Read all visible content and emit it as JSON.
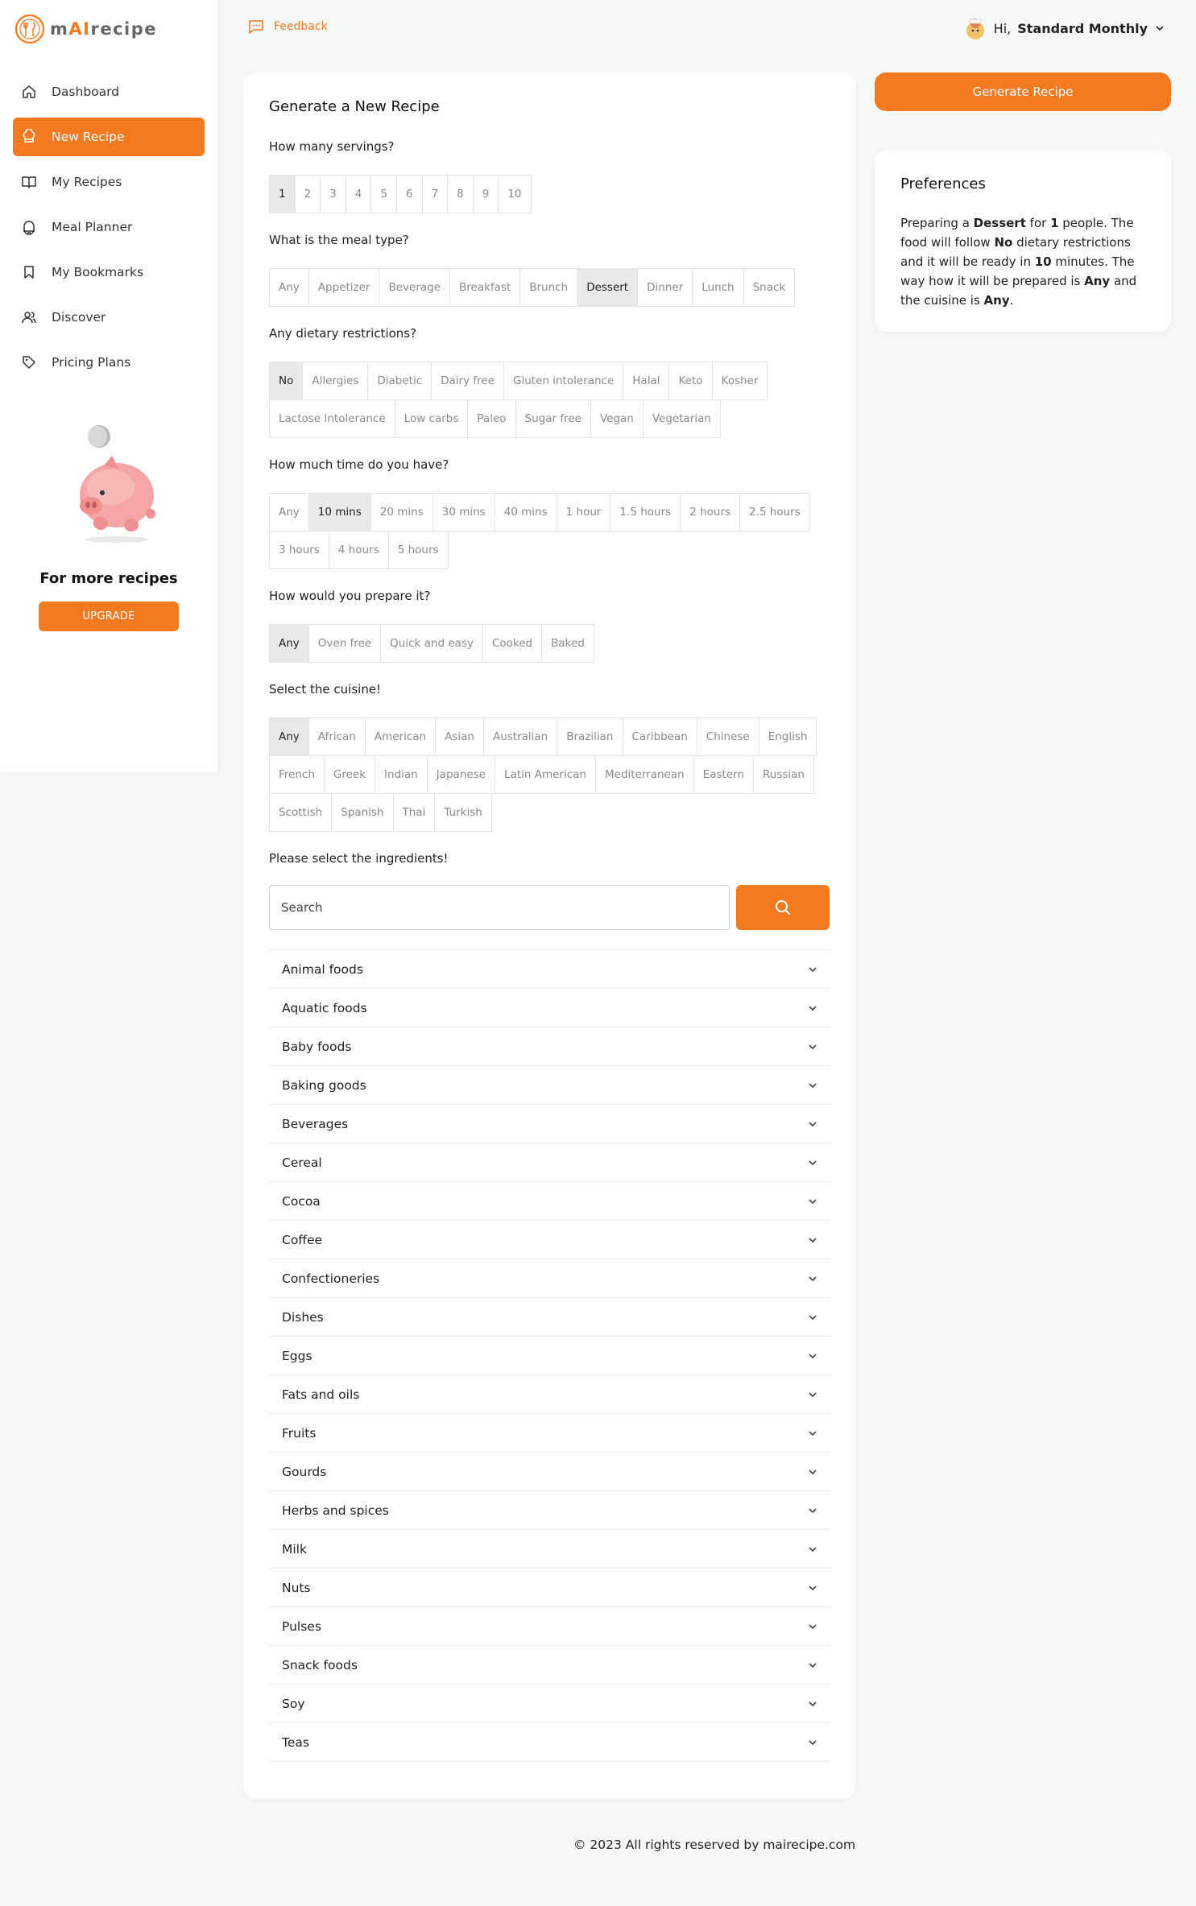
{
  "app": {
    "logo_prefix": "m",
    "logo_ai": "AI",
    "logo_suffix": "recipe"
  },
  "sidebar": {
    "items": [
      {
        "label": "Dashboard",
        "icon": "home-icon"
      },
      {
        "label": "New Recipe",
        "icon": "chef-hat-icon",
        "active": true
      },
      {
        "label": "My Recipes",
        "icon": "book-icon"
      },
      {
        "label": "Meal Planner",
        "icon": "pot-icon"
      },
      {
        "label": "My Bookmarks",
        "icon": "bookmark-icon"
      },
      {
        "label": "Discover",
        "icon": "users-icon"
      },
      {
        "label": "Pricing Plans",
        "icon": "tag-icon"
      }
    ],
    "promo_title": "For more recipes",
    "upgrade_label": "UPGRADE"
  },
  "topbar": {
    "feedback_label": "Feedback",
    "greeting": "Hi,",
    "user_name": "Standard Monthly"
  },
  "form": {
    "title": "Generate a New Recipe",
    "servings_q": "How many servings?",
    "servings": [
      "1",
      "2",
      "3",
      "4",
      "5",
      "6",
      "7",
      "8",
      "9",
      "10"
    ],
    "servings_selected": "1",
    "meal_q": "What is the meal type?",
    "meal_types": [
      "Any",
      "Appetizer",
      "Beverage",
      "Breakfast",
      "Brunch",
      "Dessert",
      "Dinner",
      "Lunch",
      "Snack"
    ],
    "meal_selected": "Dessert",
    "diet_q": "Any dietary restrictions?",
    "diet_row1": [
      "No",
      "Allergies",
      "Diabetic",
      "Dairy free",
      "Gluten intolerance",
      "Halal",
      "Keto",
      "Kosher"
    ],
    "diet_row2": [
      "Lactose Intolerance",
      "Low carbs",
      "Paleo",
      "Sugar free",
      "Vegan",
      "Vegetarian"
    ],
    "diet_selected": "No",
    "time_q": "How much time do you have?",
    "time_row1": [
      "Any",
      "10 mins",
      "20 mins",
      "30 mins",
      "40 mins",
      "1 hour",
      "1.5 hours",
      "2 hours",
      "2.5 hours"
    ],
    "time_row2": [
      "3 hours",
      "4 hours",
      "5 hours"
    ],
    "time_selected": "10 mins",
    "prep_q": "How would you prepare it?",
    "prep": [
      "Any",
      "Oven free",
      "Quick and easy",
      "Cooked",
      "Baked"
    ],
    "prep_selected": "Any",
    "cuisine_q": "Select the cuisine!",
    "cuisine_row1": [
      "Any",
      "African",
      "American",
      "Asian",
      "Australian",
      "Brazilian",
      "Caribbean",
      "Chinese",
      "English"
    ],
    "cuisine_row2": [
      "French",
      "Greek",
      "Indian",
      "Japanese",
      "Latin American",
      "Mediterranean",
      "Eastern",
      "Russian"
    ],
    "cuisine_row3": [
      "Scottish",
      "Spanish",
      "Thai",
      "Turkish"
    ],
    "cuisine_selected": "Any",
    "ingredients_q": "Please select the ingredients!",
    "search_placeholder": "Search",
    "categories": [
      "Animal foods",
      "Aquatic foods",
      "Baby foods",
      "Baking goods",
      "Beverages",
      "Cereal",
      "Cocoa",
      "Coffee",
      "Confectioneries",
      "Dishes",
      "Eggs",
      "Fats and oils",
      "Fruits",
      "Gourds",
      "Herbs and spices",
      "Milk",
      "Nuts",
      "Pulses",
      "Snack foods",
      "Soy",
      "Teas"
    ]
  },
  "right": {
    "generate_label": "Generate Recipe",
    "pref_title": "Preferences",
    "pref": {
      "t1": "Preparing a ",
      "meal": "Dessert",
      "t2": " for ",
      "servings": "1",
      "t3": " people. The food will follow ",
      "diet": "No",
      "t4": " dietary restrictions and it will be ready in ",
      "time": "10",
      "t5": " minutes. The way how it will be prepared is ",
      "prep": "Any",
      "t6": " and the cuisine is ",
      "cuisine": "Any",
      "t7": "."
    }
  },
  "footer": {
    "text": "© 2023 All rights reserved by mairecipe.com"
  },
  "colors": {
    "accent": "#f47a1f",
    "selected_bg": "#e9e9e9"
  }
}
